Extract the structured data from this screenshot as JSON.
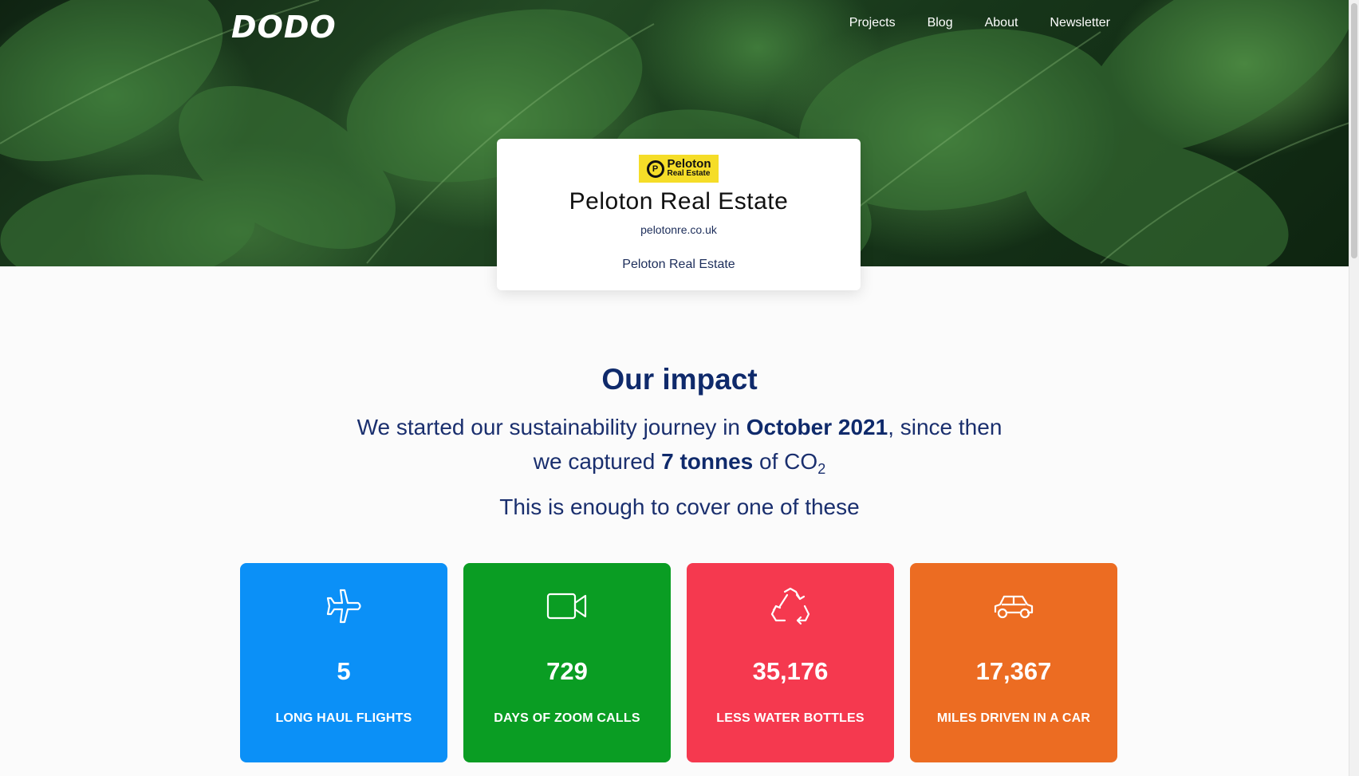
{
  "header": {
    "logo": "DODO",
    "nav": [
      "Projects",
      "Blog",
      "About",
      "Newsletter"
    ]
  },
  "company": {
    "logo_line1": "Peloton",
    "logo_line2": "Real Estate",
    "logo_mark": "P",
    "name": "Peloton Real Estate",
    "url": "pelotonre.co.uk",
    "subtitle": "Peloton Real Estate"
  },
  "impact": {
    "title": "Our impact",
    "intro": "We started our sustainability journey in",
    "date": "October 2021",
    "middle": ", since then",
    "captured": "we captured",
    "amount": "7 tonnes",
    "of": "of CO",
    "sub": "2",
    "cover": "This is enough to cover one of these"
  },
  "tiles": [
    {
      "icon": "airplane-icon",
      "value": "5",
      "label": "LONG HAUL FLIGHTS",
      "color": "#0b90f7"
    },
    {
      "icon": "video-camera-icon",
      "value": "729",
      "label": "DAYS OF ZOOM CALLS",
      "color": "#0a9d23"
    },
    {
      "icon": "recycle-icon",
      "value": "35,176",
      "label": "LESS WATER BOTTLES",
      "color": "#f5394f"
    },
    {
      "icon": "car-icon",
      "value": "17,367",
      "label": "MILES DRIVEN IN A CAR",
      "color": "#ec6c22"
    }
  ]
}
